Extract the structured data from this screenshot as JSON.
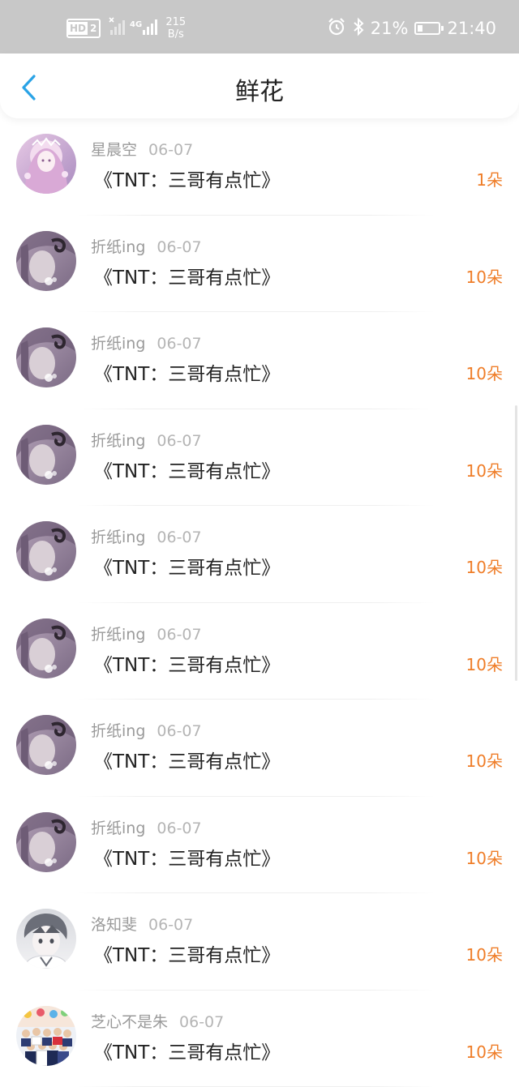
{
  "status_bar": {
    "hd_label": "HD",
    "sim_label": "2",
    "network": "4G",
    "speed_value": "215",
    "speed_unit": "B/s",
    "battery_text": "21%",
    "battery_level": 0.21,
    "time": "21:40",
    "icons": [
      "hd-icon",
      "signal-icon",
      "alarm-icon",
      "bluetooth-icon",
      "battery-icon"
    ]
  },
  "nav": {
    "title": "鲜花",
    "back_icon": "chevron-left-icon"
  },
  "colors": {
    "accent": "#2aa3e6",
    "count": "#ef7d28",
    "status_bar_bg": "#c8c8c8"
  },
  "items": [
    {
      "user": "星晨空",
      "date": "06-07",
      "book": "《TNT：三哥有点忙》",
      "count": "1朵",
      "avatar": "pink-fairy-avatar"
    },
    {
      "user": "折纸ing",
      "date": "06-07",
      "book": "《TNT：三哥有点忙》",
      "count": "10朵",
      "avatar": "purple-girl-avatar"
    },
    {
      "user": "折纸ing",
      "date": "06-07",
      "book": "《TNT：三哥有点忙》",
      "count": "10朵",
      "avatar": "purple-girl-avatar"
    },
    {
      "user": "折纸ing",
      "date": "06-07",
      "book": "《TNT：三哥有点忙》",
      "count": "10朵",
      "avatar": "purple-girl-avatar"
    },
    {
      "user": "折纸ing",
      "date": "06-07",
      "book": "《TNT：三哥有点忙》",
      "count": "10朵",
      "avatar": "purple-girl-avatar"
    },
    {
      "user": "折纸ing",
      "date": "06-07",
      "book": "《TNT：三哥有点忙》",
      "count": "10朵",
      "avatar": "purple-girl-avatar"
    },
    {
      "user": "折纸ing",
      "date": "06-07",
      "book": "《TNT：三哥有点忙》",
      "count": "10朵",
      "avatar": "purple-girl-avatar"
    },
    {
      "user": "折纸ing",
      "date": "06-07",
      "book": "《TNT：三哥有点忙》",
      "count": "10朵",
      "avatar": "purple-girl-avatar"
    },
    {
      "user": "洛知斐",
      "date": "06-07",
      "book": "《TNT：三哥有点忙》",
      "count": "10朵",
      "avatar": "gray-boy-avatar"
    },
    {
      "user": "芝心不是朱",
      "date": "06-07",
      "book": "《TNT：三哥有点忙》",
      "count": "10朵",
      "avatar": "group-photo-avatar"
    }
  ]
}
